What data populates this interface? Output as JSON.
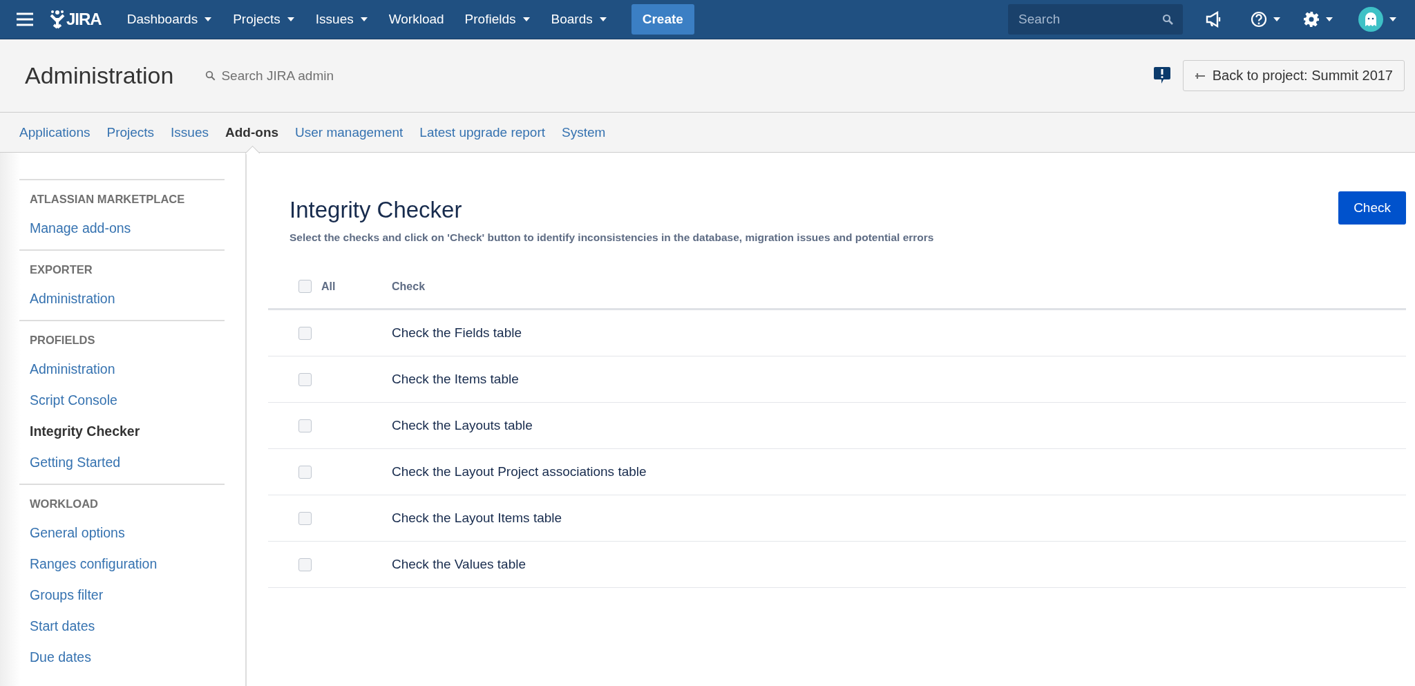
{
  "topbar": {
    "logo": "JIRA",
    "create": "Create",
    "search": {
      "placeholder": "Search"
    },
    "nav": [
      {
        "label": "Dashboards",
        "dropdown": true
      },
      {
        "label": "Projects",
        "dropdown": true
      },
      {
        "label": "Issues",
        "dropdown": true
      },
      {
        "label": "Workload",
        "dropdown": false
      },
      {
        "label": "Profields",
        "dropdown": true
      },
      {
        "label": "Boards",
        "dropdown": true
      }
    ]
  },
  "admin": {
    "title": "Administration",
    "search": {
      "placeholder": "Search JIRA admin"
    },
    "back_button": "Back to project: Summit 2017"
  },
  "tabs": [
    {
      "label": "Applications",
      "selected": false
    },
    {
      "label": "Projects",
      "selected": false
    },
    {
      "label": "Issues",
      "selected": false
    },
    {
      "label": "Add-ons",
      "selected": true
    },
    {
      "label": "User management",
      "selected": false
    },
    {
      "label": "Latest upgrade report",
      "selected": false
    },
    {
      "label": "System",
      "selected": false
    }
  ],
  "sidebar": {
    "sections": [
      {
        "heading": "ATLASSIAN MARKETPLACE",
        "items": [
          {
            "label": "Manage add-ons",
            "selected": false
          }
        ]
      },
      {
        "heading": "EXPORTER",
        "items": [
          {
            "label": "Administration",
            "selected": false
          }
        ]
      },
      {
        "heading": "PROFIELDS",
        "items": [
          {
            "label": "Administration",
            "selected": false
          },
          {
            "label": "Script Console",
            "selected": false
          },
          {
            "label": "Integrity Checker",
            "selected": true
          },
          {
            "label": "Getting Started",
            "selected": false
          }
        ]
      },
      {
        "heading": "WORKLOAD",
        "items": [
          {
            "label": "General options",
            "selected": false
          },
          {
            "label": "Ranges configuration",
            "selected": false
          },
          {
            "label": "Groups filter",
            "selected": false
          },
          {
            "label": "Start dates",
            "selected": false
          },
          {
            "label": "Due dates",
            "selected": false
          }
        ]
      }
    ]
  },
  "checker": {
    "title": "Integrity Checker",
    "description": "Select the checks and click on 'Check' button to identify inconsistencies in the database, migration issues and potential errors",
    "button": "Check",
    "columns": [
      "All",
      "Check"
    ],
    "all_checked": false,
    "rows": [
      {
        "label": "Check the Fields table",
        "checked": false
      },
      {
        "label": "Check the Items table",
        "checked": false
      },
      {
        "label": "Check the Layouts table",
        "checked": false
      },
      {
        "label": "Check the Layout Project associations table",
        "checked": false
      },
      {
        "label": "Check the Layout Items table",
        "checked": false
      },
      {
        "label": "Check the Values table",
        "checked": false
      }
    ]
  }
}
